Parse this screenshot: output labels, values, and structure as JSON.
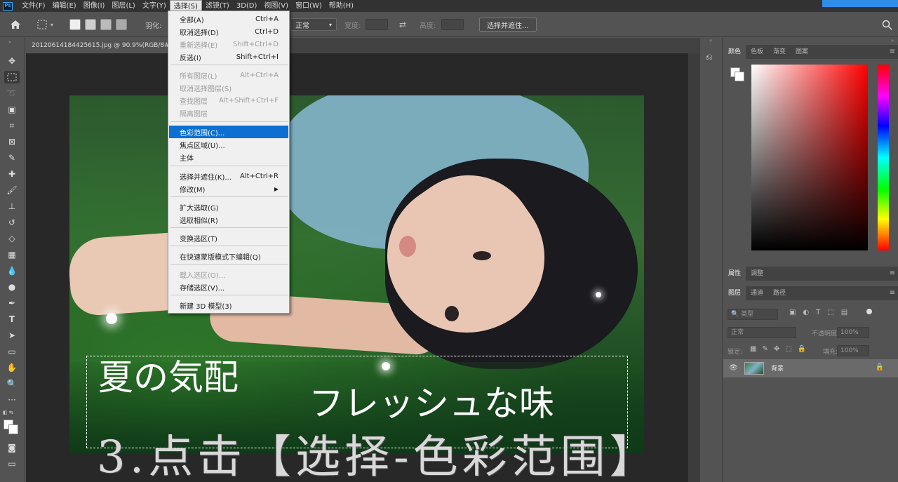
{
  "menubar": {
    "logo": "Ps",
    "items": [
      "文件(F)",
      "编辑(E)",
      "图像(I)",
      "图层(L)",
      "文字(Y)",
      "选择(S)",
      "滤镜(T)",
      "3D(D)",
      "视图(V)",
      "窗口(W)",
      "帮助(H)"
    ],
    "active_index": 5
  },
  "options": {
    "feather_label": "羽化:",
    "style_value": "正常",
    "width_label": "宽度:",
    "height_label": "高度:",
    "select_mask_button": "选择并遮住..."
  },
  "document": {
    "tab_title": "20120614184425615.jpg @ 90.9%(RGB/8#)",
    "overlay_title": "夏の気配",
    "overlay_subtitle": "フレッシュな味",
    "caption": "3.点击【选择-色彩范围】"
  },
  "dropdown": {
    "items": [
      {
        "label": "全部(A)",
        "shortcut": "Ctrl+A",
        "disabled": false
      },
      {
        "label": "取消选择(D)",
        "shortcut": "Ctrl+D",
        "disabled": false
      },
      {
        "label": "重新选择(E)",
        "shortcut": "Shift+Ctrl+D",
        "disabled": true
      },
      {
        "label": "反选(I)",
        "shortcut": "Shift+Ctrl+I",
        "disabled": false
      },
      {
        "label": "所有图层(L)",
        "shortcut": "Alt+Ctrl+A",
        "disabled": true
      },
      {
        "label": "取消选择图层(S)",
        "shortcut": "",
        "disabled": true
      },
      {
        "label": "查找图层",
        "shortcut": "Alt+Shift+Ctrl+F",
        "disabled": true
      },
      {
        "label": "隔离图层",
        "shortcut": "",
        "disabled": true
      },
      {
        "label": "色彩范围(C)...",
        "shortcut": "",
        "disabled": false,
        "highlighted": true
      },
      {
        "label": "焦点区域(U)...",
        "shortcut": "",
        "disabled": false
      },
      {
        "label": "主体",
        "shortcut": "",
        "disabled": false
      },
      {
        "label": "选择并遮住(K)...",
        "shortcut": "Alt+Ctrl+R",
        "disabled": false
      },
      {
        "label": "修改(M)",
        "shortcut": "",
        "disabled": false,
        "submenu": true
      },
      {
        "label": "扩大选取(G)",
        "shortcut": "",
        "disabled": false
      },
      {
        "label": "选取相似(R)",
        "shortcut": "",
        "disabled": false
      },
      {
        "label": "变换选区(T)",
        "shortcut": "",
        "disabled": false
      },
      {
        "label": "在快速蒙版模式下编辑(Q)",
        "shortcut": "",
        "disabled": false
      },
      {
        "label": "载入选区(O)...",
        "shortcut": "",
        "disabled": true
      },
      {
        "label": "存储选区(V)...",
        "shortcut": "",
        "disabled": false
      },
      {
        "label": "新建 3D 模型(3)",
        "shortcut": "",
        "disabled": false
      }
    ]
  },
  "color_panel": {
    "tabs": [
      "颜色",
      "色板",
      "渐变",
      "图案"
    ],
    "active_index": 0
  },
  "properties_panel": {
    "tabs": [
      "属性",
      "调整"
    ],
    "active_index": 0
  },
  "layers_panel": {
    "tabs": [
      "图层",
      "通道",
      "路径"
    ],
    "active_index": 0,
    "filter_placeholder": "类型",
    "blend_mode": "正常",
    "opacity_label": "不透明度:",
    "opacity_value": "100%",
    "lock_label": "锁定:",
    "fill_label": "填充:",
    "fill_value": "100%",
    "layer_name": "背景"
  },
  "colors": {
    "highlight": "#0c6fd1",
    "menubar_accent": "#2f8ee8"
  }
}
